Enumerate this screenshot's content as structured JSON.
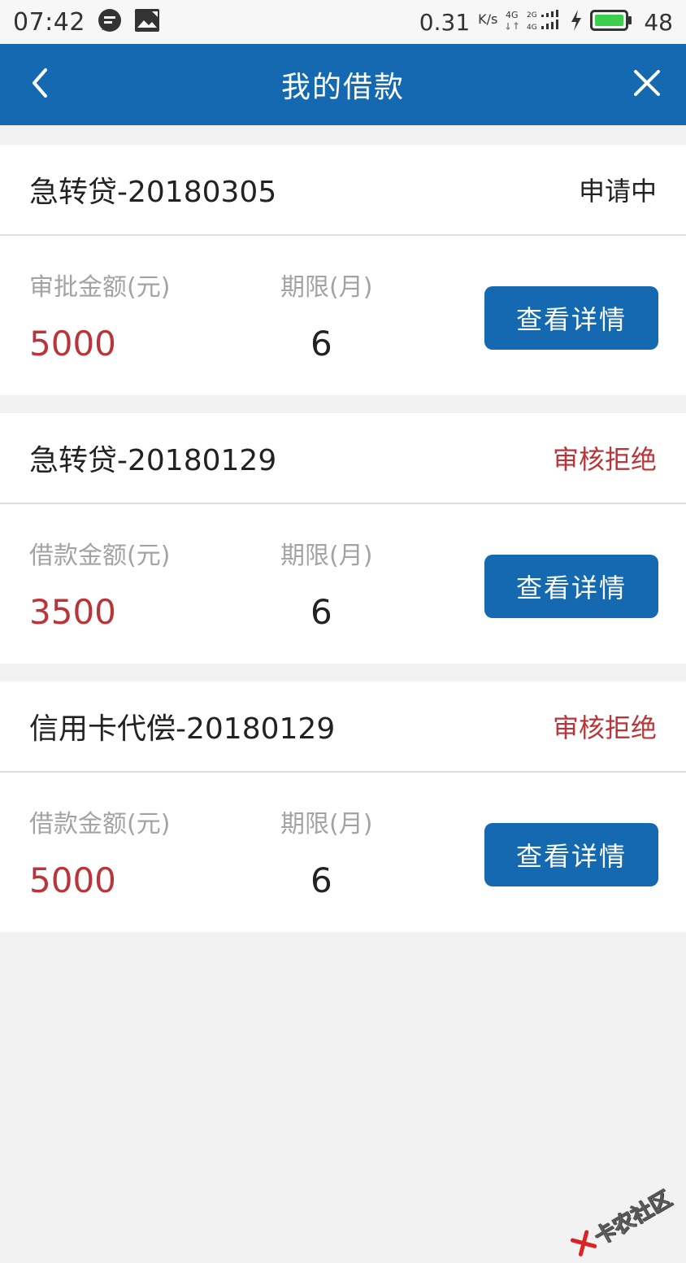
{
  "status_bar": {
    "time": "07:42",
    "net_speed": "0.31",
    "net_speed_unit": "K/s",
    "battery_level": "48",
    "icons": [
      "message-icon",
      "image-notification-icon",
      "network-4g-icon",
      "signal-icon",
      "charging-icon",
      "battery-icon"
    ]
  },
  "header": {
    "title": "我的借款",
    "back_icon": "chevron-left-icon",
    "close_icon": "close-icon"
  },
  "loans": [
    {
      "title": "急转贷-20180305",
      "status": "申请中",
      "status_type": "pending",
      "amount_label": "审批金额(元)",
      "amount": "5000",
      "term_label": "期限(月)",
      "term": "6",
      "button_label": "查看详情"
    },
    {
      "title": "急转贷-20180129",
      "status": "审核拒绝",
      "status_type": "rejected",
      "amount_label": "借款金额(元)",
      "amount": "3500",
      "term_label": "期限(月)",
      "term": "6",
      "button_label": "查看详情"
    },
    {
      "title": "信用卡代偿-20180129",
      "status": "审核拒绝",
      "status_type": "rejected",
      "amount_label": "借款金额(元)",
      "amount": "5000",
      "term_label": "期限(月)",
      "term": "6",
      "button_label": "查看详情"
    }
  ],
  "watermark": {
    "text": "卡农社区"
  },
  "colors": {
    "primary": "#1569b0",
    "rejected": "#b9353a",
    "label_gray": "#a3a3a3",
    "background": "#f2f2f2"
  }
}
